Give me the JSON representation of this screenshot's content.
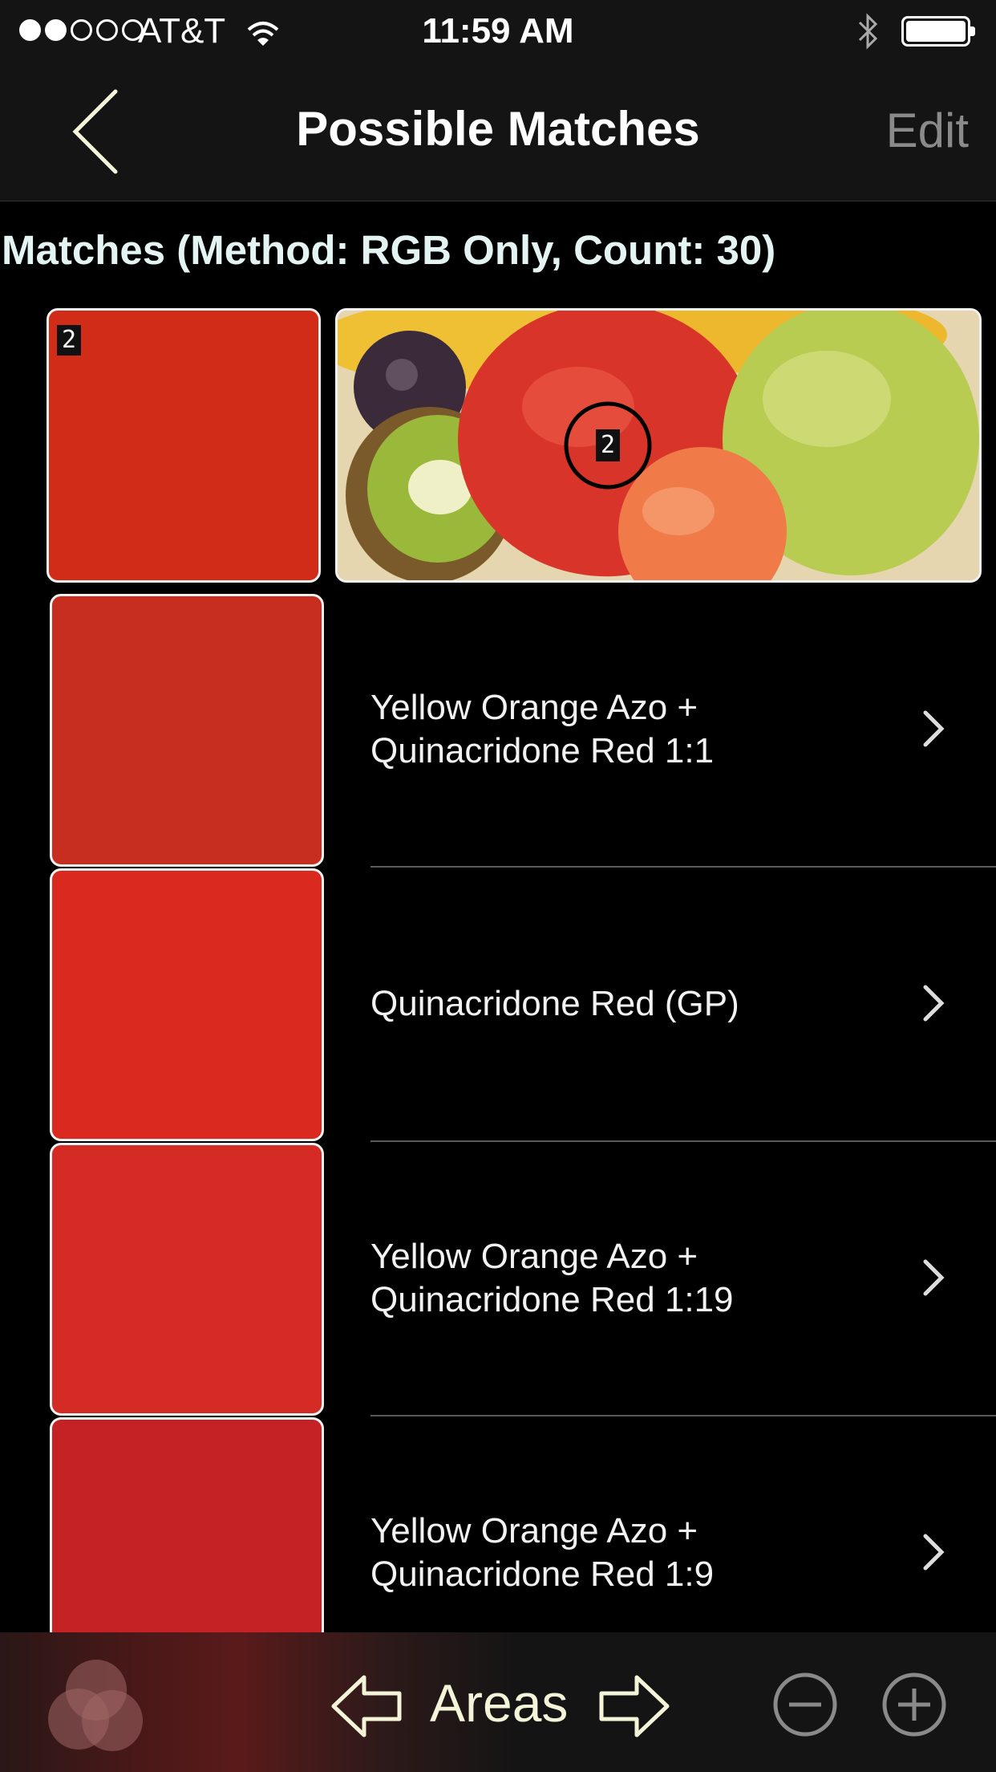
{
  "status_bar": {
    "carrier": "AT&T",
    "time": "11:59 AM",
    "signal_bars_filled": 2,
    "signal_bars_total": 5,
    "battery_level": 1.0
  },
  "nav": {
    "title": "Possible Matches",
    "edit_label": "Edit"
  },
  "section": {
    "header": "Matches (Method: RGB Only, Count: 30)"
  },
  "sample": {
    "label": "2",
    "color": "#d12c17"
  },
  "photo": {
    "marker_label": "2"
  },
  "matches": [
    {
      "label": "Yellow Orange Azo +\nQuinacridone Red 1:1",
      "color": "#c82e20"
    },
    {
      "label": "Quinacridone Red (GP)",
      "color": "#da2a20"
    },
    {
      "label": "Yellow Orange Azo +\nQuinacridone Red 1:19",
      "color": "#d42c24"
    },
    {
      "label": "Yellow Orange Azo +\nQuinacridone Red 1:9",
      "color": "#c42224"
    }
  ],
  "toolbar": {
    "areas_label": "Areas"
  },
  "colors": {
    "nav_background": "#141414",
    "header_text": "#e4f4f2",
    "edit_disabled": "#8a8a8a",
    "areas_text": "#f4f4d8"
  }
}
